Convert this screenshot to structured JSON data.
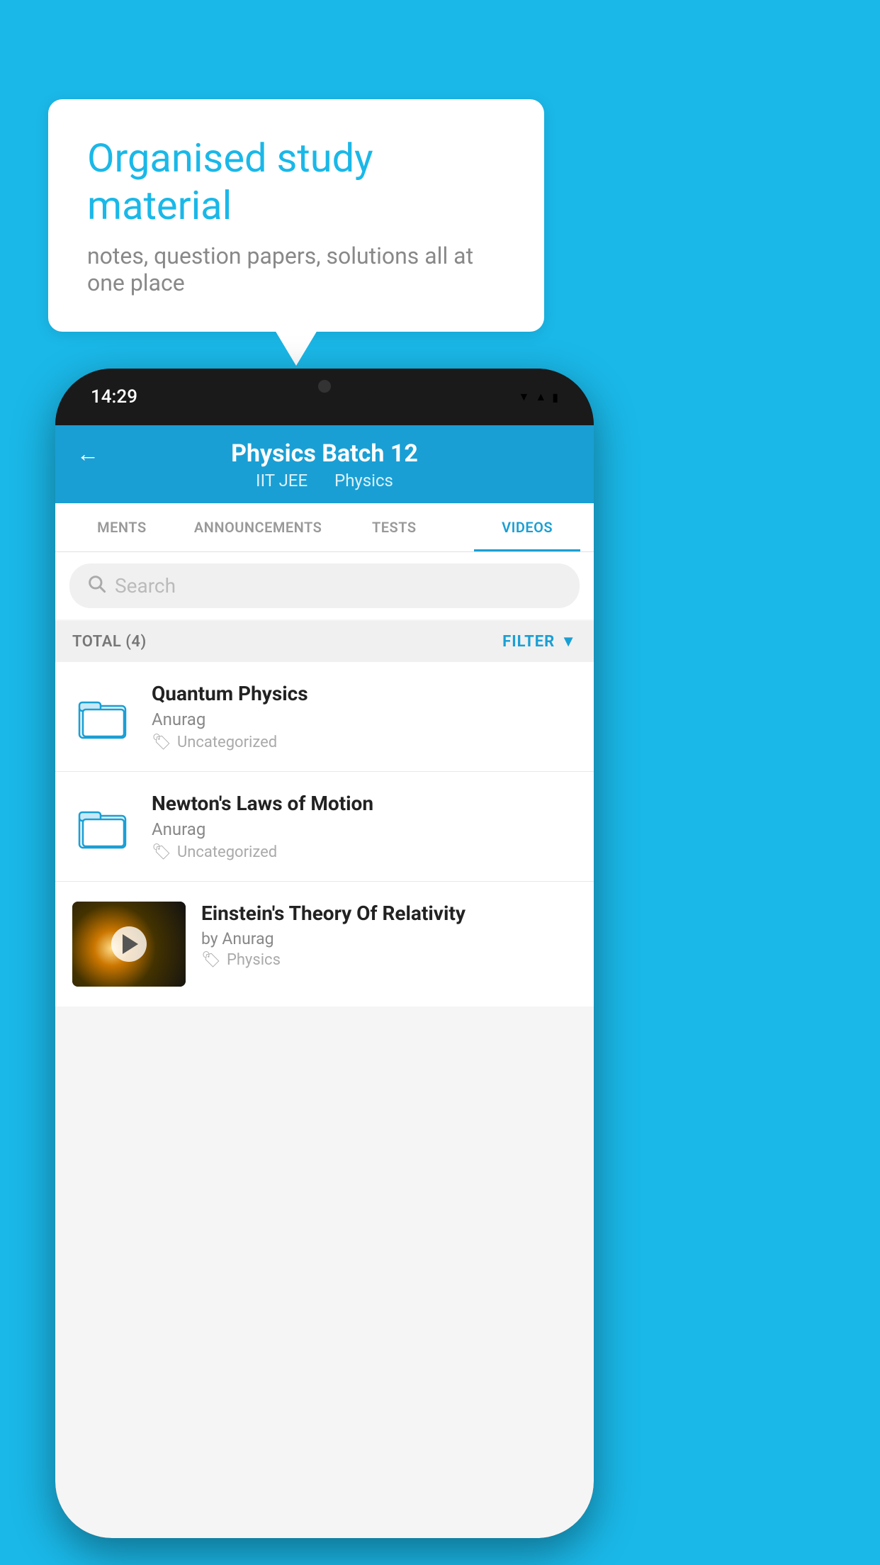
{
  "background_color": "#1ab8e8",
  "bubble": {
    "title": "Organised study material",
    "subtitle": "notes, question papers, solutions all at one place"
  },
  "phone": {
    "time": "14:29",
    "header": {
      "title": "Physics Batch 12",
      "subtitle1": "IIT JEE",
      "subtitle2": "Physics"
    },
    "tabs": [
      {
        "label": "MENTS",
        "active": false
      },
      {
        "label": "ANNOUNCEMENTS",
        "active": false
      },
      {
        "label": "TESTS",
        "active": false
      },
      {
        "label": "VIDEOS",
        "active": true
      }
    ],
    "search_placeholder": "Search",
    "total_label": "TOTAL (4)",
    "filter_label": "FILTER",
    "videos": [
      {
        "title": "Quantum Physics",
        "author": "Anurag",
        "tag": "Uncategorized",
        "type": "folder"
      },
      {
        "title": "Newton's Laws of Motion",
        "author": "Anurag",
        "tag": "Uncategorized",
        "type": "folder"
      },
      {
        "title": "Einstein's Theory Of Relativity",
        "author": "by Anurag",
        "tag": "Physics",
        "type": "video"
      }
    ]
  }
}
